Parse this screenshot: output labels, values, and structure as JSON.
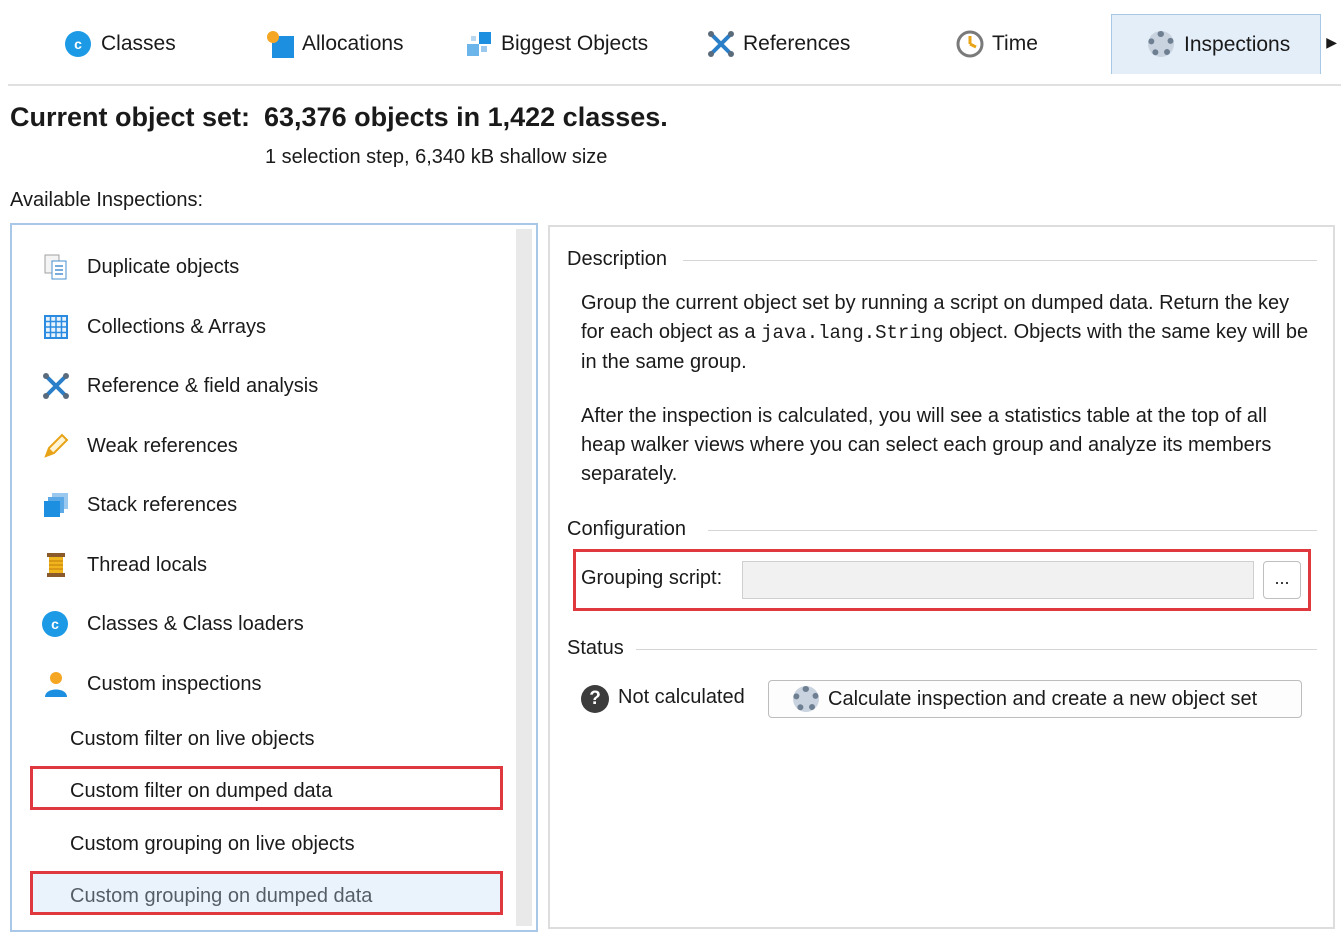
{
  "tabs": [
    {
      "label": "Classes",
      "icon": "classes-icon"
    },
    {
      "label": "Allocations",
      "icon": "allocations-icon"
    },
    {
      "label": "Biggest Objects",
      "icon": "biggest-objects-icon"
    },
    {
      "label": "References",
      "icon": "references-icon"
    },
    {
      "label": "Time",
      "icon": "clock-icon"
    },
    {
      "label": "Inspections",
      "icon": "gear-icon"
    }
  ],
  "header": {
    "label": "Current object set:",
    "value": "63,376 objects in 1,422 classes.",
    "sub": "1 selection step, 6,340 kB shallow size"
  },
  "available_label": "Available Inspections:",
  "inspections": [
    {
      "label": "Duplicate objects",
      "icon": "duplicate-objects-icon"
    },
    {
      "label": "Collections & Arrays",
      "icon": "grid-icon"
    },
    {
      "label": "Reference & field analysis",
      "icon": "references-icon"
    },
    {
      "label": "Weak references",
      "icon": "pencil-icon"
    },
    {
      "label": "Stack references",
      "icon": "stack-icon"
    },
    {
      "label": "Thread locals",
      "icon": "spool-icon"
    },
    {
      "label": "Classes & Class loaders",
      "icon": "classes-icon"
    },
    {
      "label": "Custom inspections",
      "icon": "user-icon"
    }
  ],
  "custom_items": [
    {
      "label": "Custom filter on live objects"
    },
    {
      "label": "Custom filter on dumped data"
    },
    {
      "label": "Custom grouping on live objects"
    },
    {
      "label": "Custom grouping on dumped data"
    }
  ],
  "description": {
    "title": "Description",
    "p1_a": "Group the current object set by running a script on dumped data. Return the key for each object as a ",
    "p1_code": "java.lang.String",
    "p1_b": " object. Objects with the same key will be in the same group.",
    "p2": "After the inspection is calculated, you will see a statistics table at the top of all heap walker views where you can select each group and analyze its members separately."
  },
  "configuration": {
    "title": "Configuration",
    "label": "Grouping script:",
    "value": "",
    "button": "..."
  },
  "status": {
    "title": "Status",
    "icon": "question-icon",
    "text": "Not calculated",
    "button": "Calculate inspection and create a new object set"
  },
  "colors": {
    "highlight": "#e0383f",
    "accent": "#1c9ae6"
  }
}
